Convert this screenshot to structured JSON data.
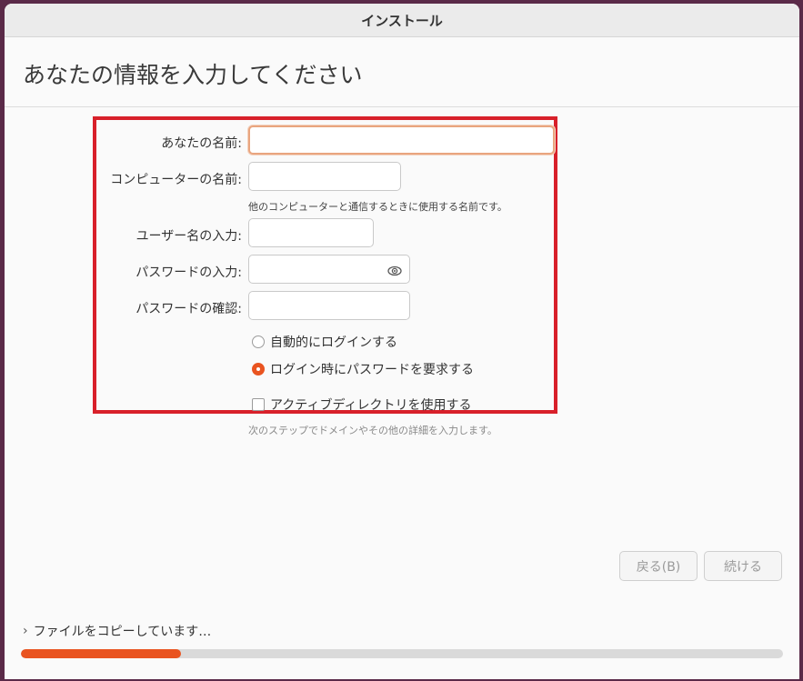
{
  "window": {
    "title": "インストール"
  },
  "page": {
    "title": "あなたの情報を入力してください"
  },
  "form": {
    "name_label": "あなたの名前:",
    "name_value": "",
    "computer_label": "コンピューターの名前:",
    "computer_value": "",
    "computer_hint": "他のコンピューターと通信するときに使用する名前です。",
    "username_label": "ユーザー名の入力:",
    "username_value": "",
    "password_label": "パスワードの入力:",
    "password_value": "",
    "confirm_label": "パスワードの確認:",
    "confirm_value": "",
    "auto_login_label": "自動的にログインする",
    "require_password_label": "ログイン時にパスワードを要求する",
    "selected_login_option": "require_password",
    "active_directory_label": "アクティブディレクトリを使用する",
    "active_directory_checked": false,
    "active_directory_hint": "次のステップでドメインやその他の詳細を入力します。"
  },
  "buttons": {
    "back_label": "戻る(B)",
    "continue_label": "続ける"
  },
  "status": {
    "text": "ファイルをコピーしています…",
    "progress": 0.21
  },
  "colors": {
    "accent": "#e95420",
    "highlight_border": "#d8202a"
  },
  "icons": {
    "password_reveal": "eye-icon",
    "status_expander": "chevron-right-icon"
  }
}
